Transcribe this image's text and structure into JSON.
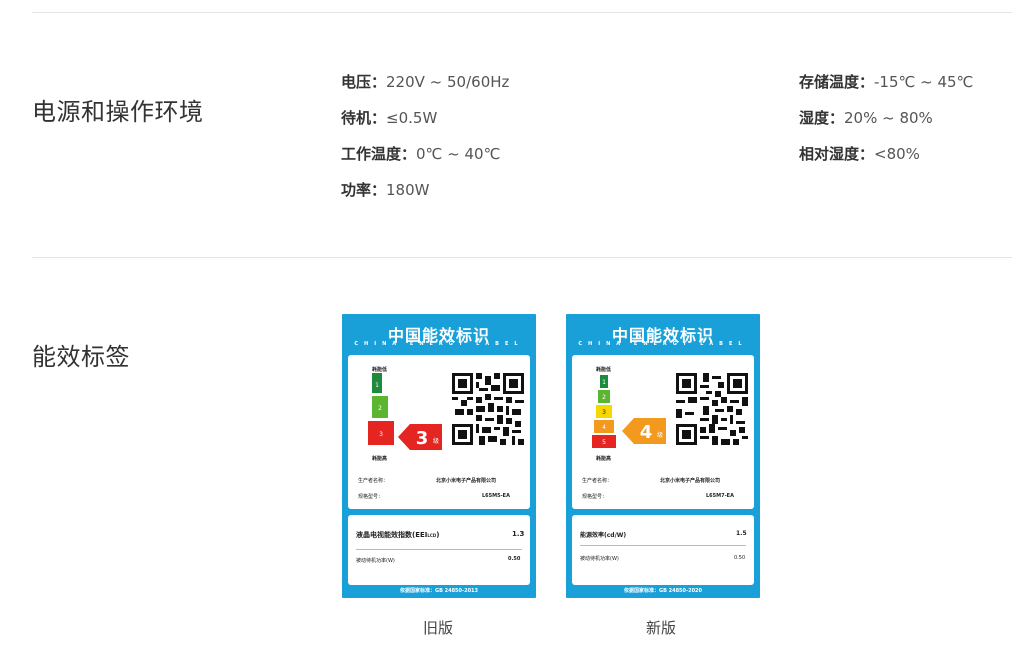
{
  "power_section": {
    "title": "电源和操作环境",
    "left_specs": [
      {
        "key": "电压：",
        "value": "220V ~ 50/60Hz"
      },
      {
        "key": "待机：",
        "value": "≤0.5W"
      },
      {
        "key": "工作温度：",
        "value": "0℃ ~ 40℃"
      },
      {
        "key": "功率：",
        "value": "180W"
      }
    ],
    "right_specs": [
      {
        "key": "存储温度：",
        "value": "-15℃ ~ 45℃"
      },
      {
        "key": "湿度：",
        "value": "20% ~ 80%"
      },
      {
        "key": "相对湿度：",
        "value": "<80%"
      }
    ]
  },
  "energy_section": {
    "title": "能效标签",
    "labels": [
      {
        "title": "中国能效标识",
        "subtitle": "CHINA ENERGY LABEL",
        "low": "耗能低",
        "high": "耗能高",
        "levels": [
          "1",
          "2",
          "3"
        ],
        "grade": "3",
        "grade_unit": "级",
        "producer_key": "生产者名称：",
        "producer_value": "北京小米电子产品有限公司",
        "model_key": "规格型号：",
        "model_value": "L65M5-EA",
        "metric1_key": "液晶电视能效指数(EEI",
        "metric1_sub": "LCD",
        "metric1_close": ")",
        "metric1_value": "1.3",
        "metric2_key": "被动待机功率(W)",
        "metric2_value": "0.50",
        "footer": "依据国家标准：GB 24850-2013",
        "caption": "旧版"
      },
      {
        "title": "中国能效标识",
        "subtitle": "CHINA ENERGY LABEL",
        "low": "耗能低",
        "high": "耗能高",
        "levels": [
          "1",
          "2",
          "3",
          "4",
          "5"
        ],
        "grade": "4",
        "grade_unit": "级",
        "producer_key": "生产者名称：",
        "producer_value": "北京小米电子产品有限公司",
        "model_key": "规格型号：",
        "model_value": "L65M7-EA",
        "metric1_key": "能源效率(cd/W)",
        "metric1_value": "1.5",
        "metric2_key": "被动待机功率(W)",
        "metric2_value": "0.50",
        "footer": "依据国家标准：GB 24850-2020",
        "caption": "新版"
      }
    ]
  },
  "colors": {
    "label_blue": "#1aa0d8",
    "grade_green_dark": "#1e8a3c",
    "grade_green": "#5cb531",
    "grade_yellow": "#f5d800",
    "grade_orange": "#f39a1e",
    "grade_red": "#e52521"
  }
}
